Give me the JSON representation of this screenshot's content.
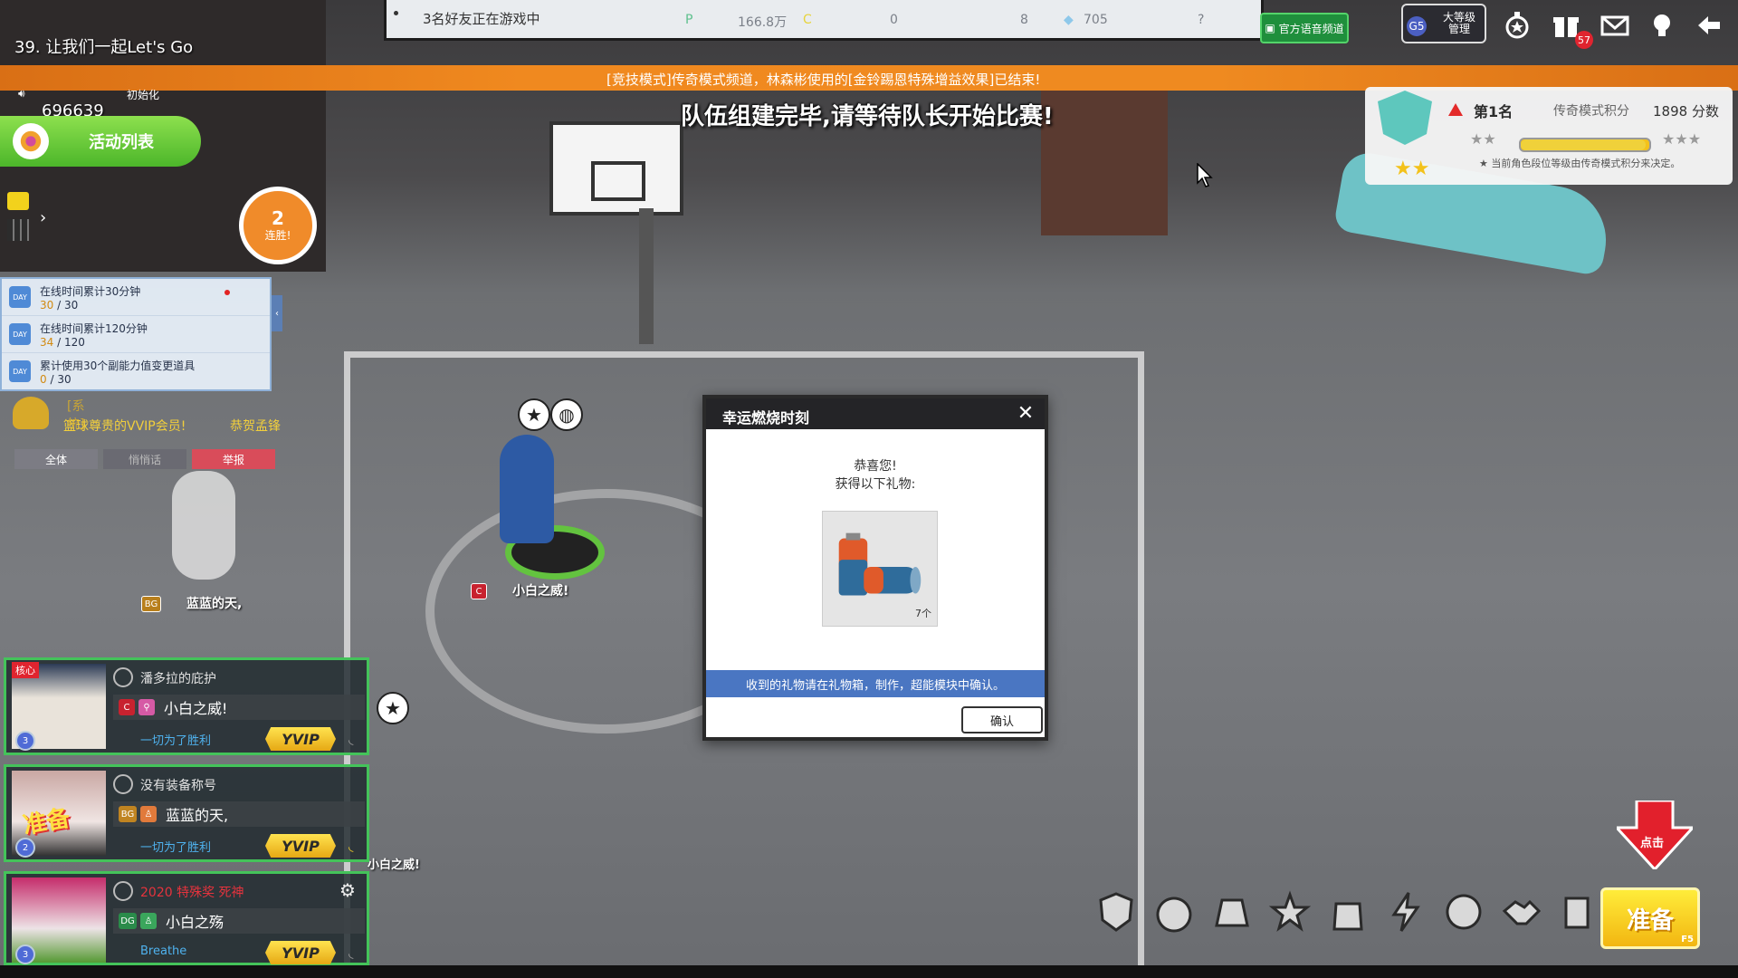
{
  "top_notice": {
    "friends_online": "3名好友正在游戏中",
    "stat_p": "166.8万",
    "stat_c": "0",
    "stat_tickets": "8",
    "stat_gems": "705"
  },
  "voice_channel_label": "官方语音频道",
  "level_box": {
    "badge": "G5",
    "line1": "大等级",
    "line2": "管理"
  },
  "mail_badge": "57",
  "player_header": {
    "name": "39. 让我们一起Let's Go",
    "sub": "初始化",
    "score": "696639"
  },
  "banner_text": "[竞技模式]传奇模式频道，林森彬使用的[金铃踢恩特殊增益效果]已结束!",
  "team_message": "队伍组建完毕,请等待队长开始比赛!",
  "activity_button": "活动列表",
  "streak": {
    "count": "2",
    "label": "连胜!"
  },
  "tasks": [
    {
      "name": "在线时间累计30分钟",
      "current": "30",
      "total": "30",
      "dot": true
    },
    {
      "name": "在线时间累计120分钟",
      "current": "34",
      "total": "120",
      "dot": false
    },
    {
      "name": "累计使用30个副能力值变更道具",
      "current": "0",
      "total": "30",
      "dot": false
    }
  ],
  "system_chat": {
    "tag": "[系统]",
    "message": "篮球尊贵的VVIP会员!",
    "message2": "恭贺孟锋"
  },
  "chat_tabs": {
    "all": "全体",
    "team": "悄悄话",
    "report": "举报"
  },
  "scene_labels": {
    "player": "小白之威!",
    "ghost": "蓝蓝的天,",
    "team_badge": "BG",
    "player_badge": "C",
    "chat_snippet": "小白之威!"
  },
  "cards": [
    {
      "title": "潘多拉的庇护",
      "title_red": false,
      "tag1": "C",
      "name": "小白之威!",
      "motto": "一切为了胜利",
      "vip": "YVIP",
      "corner": "核心"
    },
    {
      "title": "没有装备称号",
      "title_red": false,
      "tag1": "BG",
      "name": "蓝蓝的天,",
      "motto": "一切为了胜利",
      "vip": "YVIP",
      "corner": "准备"
    },
    {
      "title": "2020 特殊奖 死神",
      "title_red": true,
      "tag1": "DG",
      "name": "小白之殇",
      "motto": "Breathe",
      "vip": "YVIP",
      "corner": ""
    }
  ],
  "rank_panel": {
    "place": "第1名",
    "mode": "传奇模式积分",
    "points": "1898 分数",
    "progress": 0.97,
    "note": "★ 当前角色段位等级由传奇模式积分来决定。"
  },
  "modal": {
    "title": "幸运燃烧时刻",
    "congrats": "恭喜您!",
    "gets": "获得以下礼物:",
    "item_qty": "7个",
    "info": "收到的礼物请在礼物箱，制作，超能模块中确认。",
    "confirm": "确认"
  },
  "click_hint": "点击",
  "ready_button": {
    "label": "准备",
    "key": "F5"
  },
  "toolbar_icons": [
    "badge-icon",
    "stopwatch-icon",
    "court-icon",
    "team-icon",
    "backpack-icon",
    "lightning-icon",
    "basketball-icon",
    "handshake-icon",
    "cards-icon"
  ]
}
